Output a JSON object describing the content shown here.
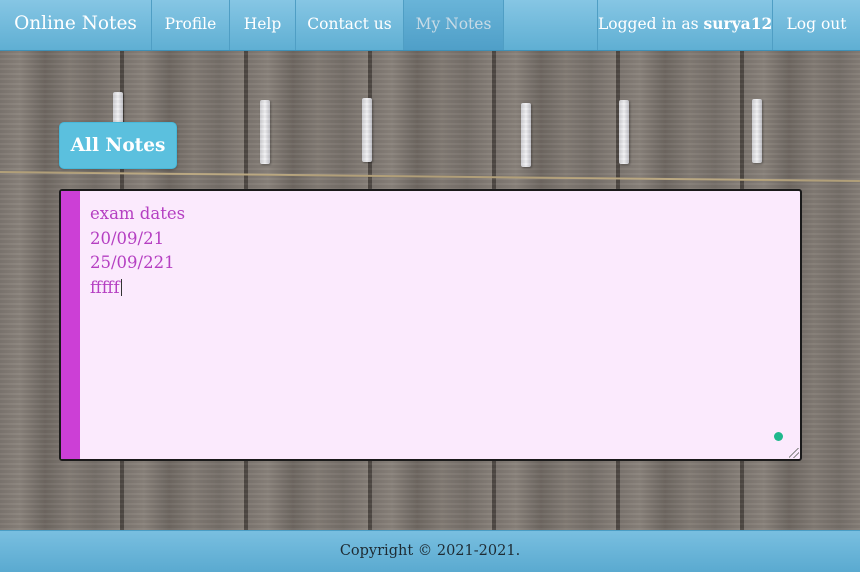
{
  "navbar": {
    "brand": "Online Notes",
    "items": [
      {
        "label": "Profile"
      },
      {
        "label": "Help"
      },
      {
        "label": "Contact us"
      },
      {
        "label": "My Notes",
        "active": true
      }
    ],
    "logged_in_prefix": "Logged in as ",
    "username": "surya12",
    "logout_label": "Log out"
  },
  "all_notes_button": "All Notes",
  "note": {
    "lines": [
      "exam dates",
      "20/09/21",
      "25/09/221",
      "fffff"
    ],
    "stripe_color": "#cc3fd6",
    "text_color": "#b53fc2",
    "background_color": "#fbeafd"
  },
  "footer": {
    "copyright": "Copyright © 2021-2021."
  },
  "colors": {
    "navbar": "#5fafd3",
    "button": "#5bc0de",
    "status_dot": "#1fb88d"
  }
}
